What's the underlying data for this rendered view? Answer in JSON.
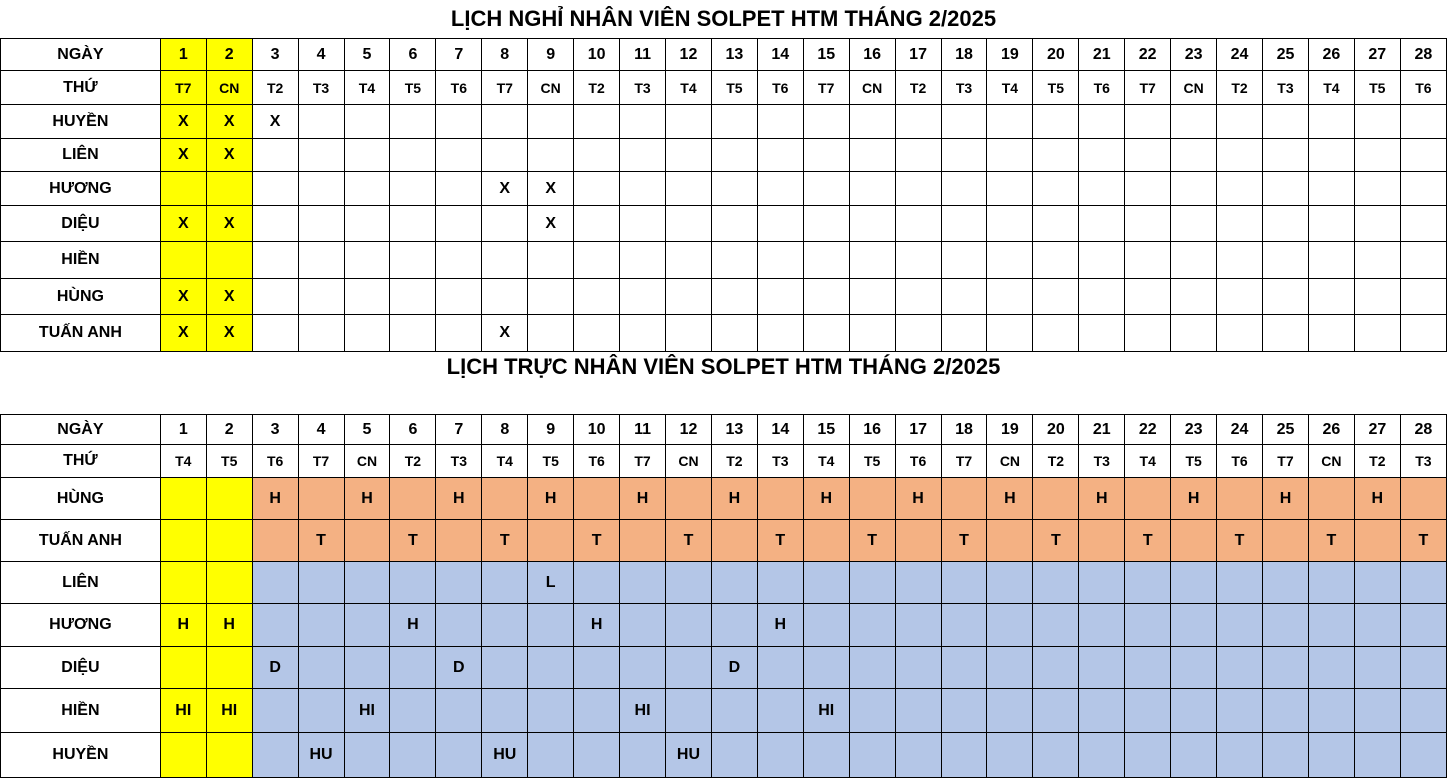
{
  "leave": {
    "title": "LỊCH NGHỈ NHÂN VIÊN SOLPET HTM THÁNG 2/2025",
    "day_label": "NGÀY",
    "dow_label": "THỨ",
    "days": [
      "1",
      "2",
      "3",
      "4",
      "5",
      "6",
      "7",
      "8",
      "9",
      "10",
      "11",
      "12",
      "13",
      "14",
      "15",
      "16",
      "17",
      "18",
      "19",
      "20",
      "21",
      "22",
      "23",
      "24",
      "25",
      "26",
      "27",
      "28"
    ],
    "dows": [
      "T7",
      "CN",
      "T2",
      "T3",
      "T4",
      "T5",
      "T6",
      "T7",
      "CN",
      "T2",
      "T3",
      "T4",
      "T5",
      "T6",
      "T7",
      "CN",
      "T2",
      "T3",
      "T4",
      "T5",
      "T6",
      "T7",
      "CN",
      "T2",
      "T3",
      "T4",
      "T5",
      "T6"
    ],
    "rows": [
      {
        "name": "HUYỀN",
        "marks": {
          "1": "X",
          "2": "X",
          "3": "X"
        }
      },
      {
        "name": "LIÊN",
        "marks": {
          "1": "X",
          "2": "X"
        }
      },
      {
        "name": "HƯƠNG",
        "marks": {
          "8": "X",
          "9": "X"
        }
      },
      {
        "name": "DIỆU",
        "marks": {
          "1": "X",
          "2": "X",
          "9": "X"
        }
      },
      {
        "name": "HIỀN",
        "marks": {}
      },
      {
        "name": "HÙNG",
        "marks": {
          "1": "X",
          "2": "X"
        }
      },
      {
        "name": "TUẤN ANH",
        "marks": {
          "1": "X",
          "2": "X",
          "8": "X"
        }
      }
    ],
    "highlight_days": [
      "1",
      "2"
    ]
  },
  "duty": {
    "title": "LỊCH TRỰC NHÂN VIÊN SOLPET HTM THÁNG 2/2025",
    "day_label": "NGÀY",
    "dow_label": "THỨ",
    "days": [
      "1",
      "2",
      "3",
      "4",
      "5",
      "6",
      "7",
      "8",
      "9",
      "10",
      "11",
      "12",
      "13",
      "14",
      "15",
      "16",
      "17",
      "18",
      "19",
      "20",
      "21",
      "22",
      "23",
      "24",
      "25",
      "26",
      "27",
      "28"
    ],
    "dows": [
      "T4",
      "T5",
      "T6",
      "T7",
      "CN",
      "T2",
      "T3",
      "T4",
      "T5",
      "T6",
      "T7",
      "CN",
      "T2",
      "T3",
      "T4",
      "T5",
      "T6",
      "T7",
      "CN",
      "T2",
      "T3",
      "T4",
      "T5",
      "T6",
      "T7",
      "CN",
      "T2",
      "T3"
    ],
    "rows": [
      {
        "name": "HÙNG",
        "group": "orange",
        "marks": {
          "3": "H",
          "5": "H",
          "7": "H",
          "9": "H",
          "11": "H",
          "13": "H",
          "15": "H",
          "17": "H",
          "19": "H",
          "21": "H",
          "23": "H",
          "25": "H",
          "27": "H"
        }
      },
      {
        "name": "TUẤN ANH",
        "group": "orange",
        "marks": {
          "4": "T",
          "6": "T",
          "8": "T",
          "10": "T",
          "12": "T",
          "14": "T",
          "16": "T",
          "18": "T",
          "20": "T",
          "22": "T",
          "24": "T",
          "26": "T",
          "28": "T"
        }
      },
      {
        "name": "LIÊN",
        "group": "blue",
        "marks": {
          "9": "L"
        }
      },
      {
        "name": "HƯƠNG",
        "group": "blue",
        "marks": {
          "1": "H",
          "2": "H",
          "6": "H",
          "10": "H",
          "14": "H"
        }
      },
      {
        "name": "DIỆU",
        "group": "blue",
        "marks": {
          "3": "D",
          "7": "D",
          "13": "D"
        }
      },
      {
        "name": "HIỀN",
        "group": "blue",
        "marks": {
          "1": "HI",
          "2": "HI",
          "5": "HI",
          "11": "HI",
          "15": "HI"
        }
      },
      {
        "name": "HUYỀN",
        "group": "blue",
        "marks": {
          "4": "HU",
          "8": "HU",
          "12": "HU"
        }
      }
    ],
    "highlight_days": [
      "1",
      "2"
    ]
  },
  "colors": {
    "highlight": "#ffff00",
    "orange_group": "#f4b183",
    "blue_group": "#b4c6e7"
  }
}
